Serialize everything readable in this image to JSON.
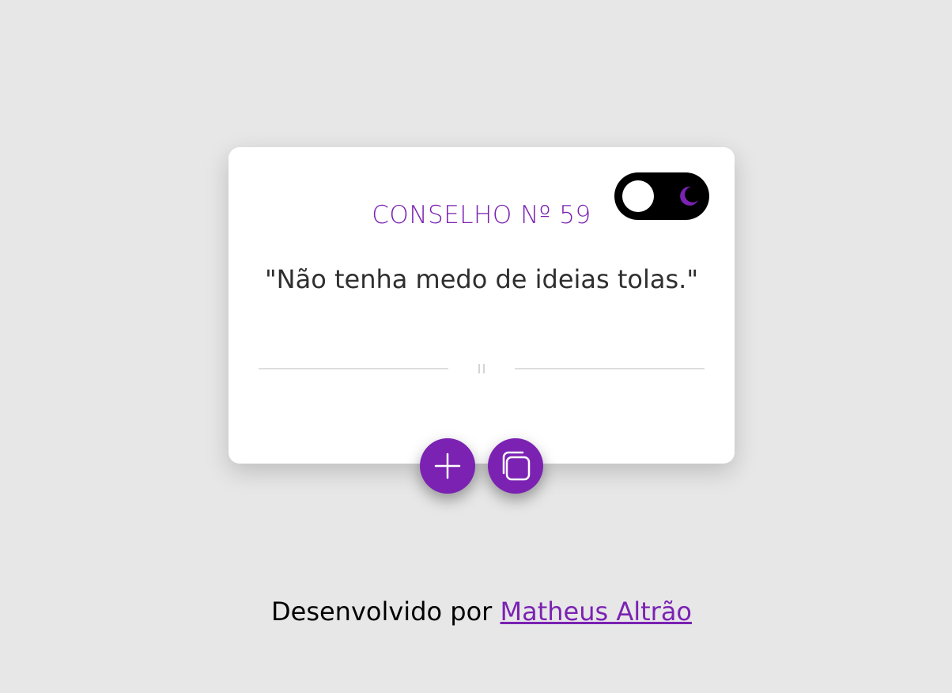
{
  "card": {
    "title": "CONSELHO Nº 59",
    "advice": "\"Não tenha medo de ideias tolas.\""
  },
  "theme_toggle": {
    "icons": [
      "sun-circle",
      "moon-icon"
    ]
  },
  "actions": {
    "new_advice_icon": "plus-icon",
    "copy_icon": "copy-icon"
  },
  "footer": {
    "prefix": "Desenvolvido por",
    "author": "Matheus Altrão"
  },
  "colors": {
    "accent": "#7b22b3",
    "background": "#e7e7e7",
    "card": "#ffffff",
    "toggle": "#000000",
    "text": "#2f2f2f"
  }
}
